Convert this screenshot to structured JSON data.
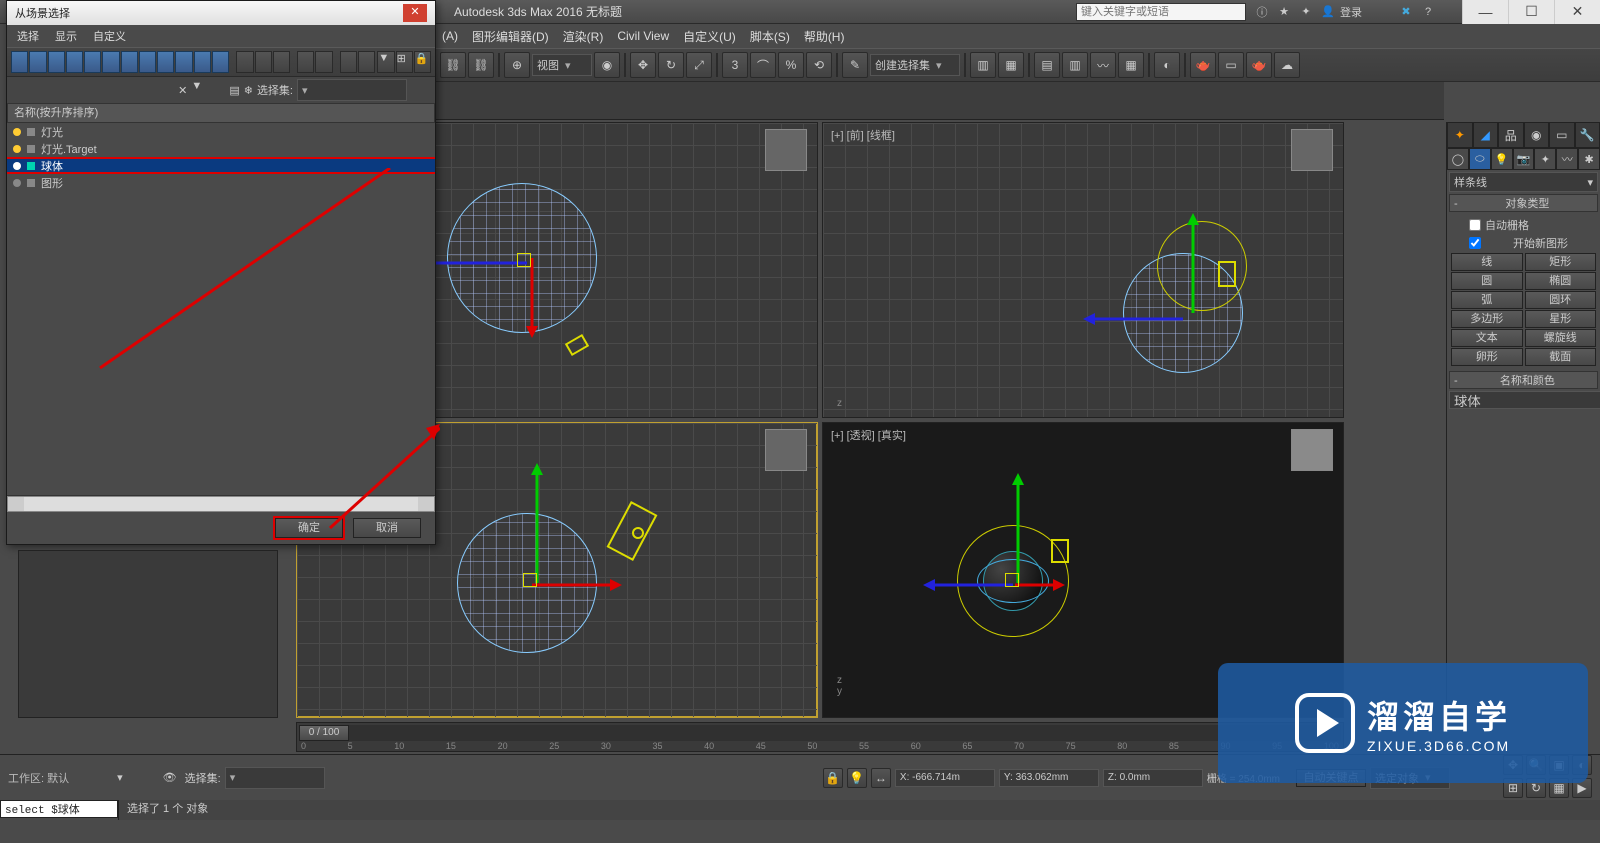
{
  "app": {
    "title": "Autodesk 3ds Max 2016    无标题",
    "search_placeholder": "键入关键字或短语",
    "login": "登录"
  },
  "window_controls": {
    "min": "—",
    "max": "☐",
    "close": "✕"
  },
  "main_menu": {
    "items": [
      "​(A)",
      "图形编辑器(D)",
      "渲染(R)",
      "Civil View",
      "自定义(U)",
      "脚本(S)",
      "帮助(H)"
    ]
  },
  "main_toolbar": {
    "view_dropdown": "视图",
    "selection_set": "创建选择集"
  },
  "viewports": {
    "top_left": "",
    "top_right": "[+] [前] [线框]",
    "bottom_left": "",
    "bottom_right": "[+] [透视] [真实]"
  },
  "cmd_panel": {
    "shape_dropdown": "样条线",
    "rollout_type": "对象类型",
    "auto_grid": "自动栅格",
    "start_new": "开始新图形",
    "buttons": {
      "line": "线",
      "rect": "矩形",
      "circle": "圆",
      "ellipse": "椭圆",
      "arc": "弧",
      "donut": "圆环",
      "ngon": "多边形",
      "star": "星形",
      "text": "文本",
      "helix": "螺旋线",
      "egg": "卵形",
      "section": "截面"
    },
    "rollout_name": "名称和颜色",
    "obj_name": "球体"
  },
  "dialog": {
    "title": "从场景选择",
    "menu": [
      "选择",
      "显示",
      "自定义"
    ],
    "filter_label": "选择集:",
    "list_header": "名称(按升序排序)",
    "items": [
      {
        "label": "灯光",
        "type": "light"
      },
      {
        "label": "灯光.Target",
        "type": "light"
      },
      {
        "label": "球体",
        "type": "geom",
        "selected": true
      },
      {
        "label": "图形",
        "type": "shape"
      }
    ],
    "ok": "确定",
    "cancel": "取消"
  },
  "timeline": {
    "current": "0 / 100",
    "ticks": [
      "0",
      "5",
      "10",
      "15",
      "20",
      "25",
      "30",
      "35",
      "40",
      "45",
      "50",
      "55",
      "60",
      "65",
      "70",
      "75",
      "80",
      "85",
      "90",
      "95",
      "100"
    ]
  },
  "status": {
    "workspace": "工作区: 默认",
    "selection_set": "选择集:",
    "x": "X: -666.714m",
    "y": "Y: 363.062mm",
    "z": "Z: 0.0mm",
    "grid": "栅格 = 254.0mm",
    "auto_key": "自动关键点",
    "set_key_target": "选定对象"
  },
  "maxscript": {
    "input": "select $球体",
    "status": "选择了 1 个 对象"
  },
  "watermark": {
    "big": "溜溜自学",
    "small": "ZIXUE.3D66.COM"
  }
}
